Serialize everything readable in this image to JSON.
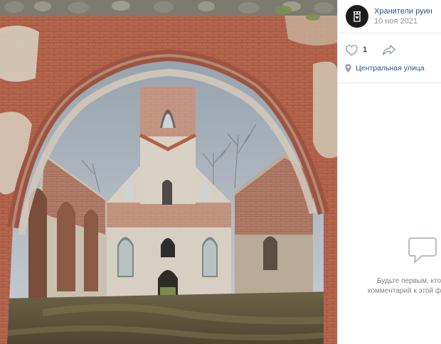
{
  "post": {
    "author_name": "Хранители руин",
    "date": "10 ноя 2021",
    "likes_count": "1",
    "location": "Центральная улица"
  },
  "comments_empty": {
    "line1": "Будьте первым, кто",
    "line2": "комментарий к этой ф"
  },
  "colors": {
    "link": "#2a5885",
    "muted": "#939393",
    "icon": "#99a2ad",
    "like_accent": "#4a76a8"
  },
  "icons": {
    "avatar": "castle-tower-logo",
    "like": "heart-icon",
    "share": "share-arrow-icon",
    "location": "location-pin-icon",
    "empty_comments": "speech-bubble-icon"
  }
}
